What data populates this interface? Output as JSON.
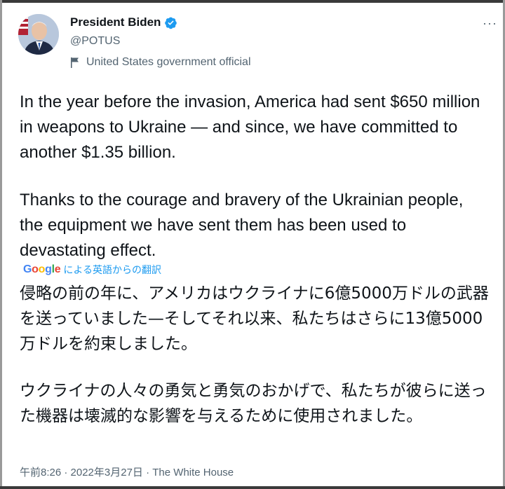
{
  "author": {
    "display_name": "President Biden",
    "handle": "@POTUS",
    "label": "United States government official",
    "avatar": "avatar-photo",
    "verified_icon": "verified-badge-icon",
    "label_icon": "government-flag-icon"
  },
  "menu": {
    "more_label": "···"
  },
  "tweet": {
    "paragraph_1": "In the year before the invasion, America had sent $650 million in weapons to Ukraine — and since, we have committed to another $1.35 billion.",
    "paragraph_2": "Thanks to the courage and bravery of the Ukrainian people, the equipment we have sent them has been used to devastating effect."
  },
  "translation": {
    "provider": "Google",
    "label": "による英語からの翻訳",
    "paragraph_1": "侵略の前の年に、アメリカはウクライナに6億5000万ドルの武器を送っていました—そしてそれ以来、私たちはさらに13億5000万ドルを約束しました。",
    "paragraph_2": "ウクライナの人々の勇気と勇気のおかげで、私たちが彼らに送った機器は壊滅的な影響を与えるために使用されました。"
  },
  "meta": {
    "timestamp": "午前8:26 · 2022年3月27日",
    "separator": " · ",
    "source": "The White House"
  },
  "colors": {
    "text": "#0f1419",
    "secondary": "#536471",
    "link": "#1d9bf0",
    "verified": "#1d9bf0"
  }
}
